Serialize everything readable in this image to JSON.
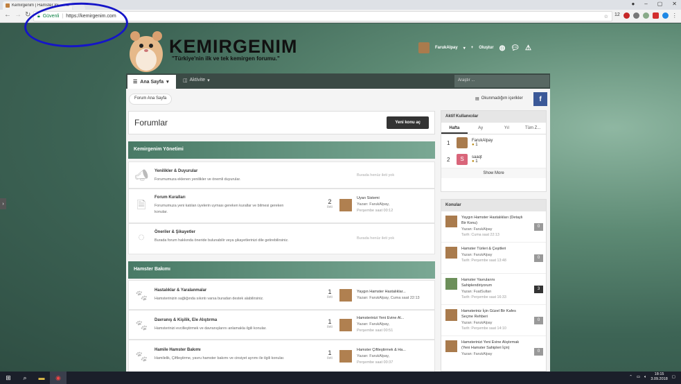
{
  "browser": {
    "tab_title": "Kemirgenim | Hamster Ini",
    "address_secure": "Güvenli",
    "address_url": "https://kemirgenim.com",
    "ext_number": "12"
  },
  "site": {
    "brand": "KEMIRGENIM",
    "tagline": "\"Türkiye'nin ilk ve tek kemirgen forumu.\"",
    "username": "FarukAlpay",
    "create_label": "Oluştur"
  },
  "nav": {
    "home": "Ana Sayfa",
    "activity": "Aktivite",
    "search_placeholder": "Araştır ..."
  },
  "breadcrumb": "Forum Ana Sayfa",
  "unread_label": "Okunmadığım içerikler",
  "fb_label": "f",
  "forums_title": "Forumlar",
  "new_topic": "Yeni konu aç",
  "categories": [
    {
      "title": "Kemirgenim Yönetimi",
      "forums": [
        {
          "name": "Yenilikler & Duyurular",
          "desc": "Forumumuza eklenen yenilikler ve önemli duyurular.",
          "empty": "Burada henüz ileti yok"
        },
        {
          "name": "Forum Kuralları",
          "desc": "Forumumuza yeni katılan üyelerin uyması gereken kurallar ve bilmesi gereken konular.",
          "count": "2",
          "count_label": "ileti",
          "last_title": "Uyarı Sistemi",
          "last_by": "Yazan: FarukAlpay,",
          "last_time": "Perşembe saat 00:12"
        },
        {
          "name": "Öneriler & Şikayetler",
          "desc": "Burada forum hakkında öneride bulunabilir veya şikayetlerinizi dile getirebilirsiniz.",
          "empty": "Burada henüz ileti yok"
        }
      ]
    },
    {
      "title": "Hamster Bakımı",
      "forums": [
        {
          "name": "Hastalıklar & Yaralanmalar",
          "desc": "Hamsterinizin sağlığında sıkıntı varsa buradan destek alabilirsiniz.",
          "count": "1",
          "count_label": "ileti",
          "last_title": "Yaygın Hamster Hastalıklar...",
          "last_by": "Yazan: FarukAlpay, Cuma saat 22:13",
          "last_time": ""
        },
        {
          "name": "Davranış & Kişilik, Ele Alıştırma",
          "desc": "Hamsterinizi evcilleştirmek ve davranışlarını anlamakla ilgili konular.",
          "count": "1",
          "count_label": "ileti",
          "last_title": "Hamsterinizi Yeni Evine Al...",
          "last_by": "Yazan: FarukAlpay,",
          "last_time": "Perşembe saat 00:51"
        },
        {
          "name": "Hamile Hamster Bakımı",
          "desc": "Hamilelik, Çiftleştirme, yavru hamster bakımı ve cinsiyet ayrımı ile ilgili konular.",
          "count": "1",
          "count_label": "ileti",
          "last_title": "Hamster Çiftleştirmek & Ha...",
          "last_by": "Yazan: FarukAlpay,",
          "last_time": "Perşembe saat 00:37"
        }
      ]
    }
  ],
  "active_users": {
    "title": "Aktif Kullanıcılar",
    "tabs": [
      "Hafta",
      "Ay",
      "Yıl",
      "Tüm Z..."
    ],
    "users": [
      {
        "rank": "1",
        "name": "FarukAlpay",
        "points": "1",
        "color": "#a97b4d",
        "initial": ""
      },
      {
        "rank": "2",
        "name": "saaqt",
        "points": "1",
        "color": "#d9657a",
        "initial": "S"
      }
    ],
    "show_more": "Show More"
  },
  "topics": {
    "title": "Konular",
    "items": [
      {
        "title": "Yaygın Hamster Hastalıkları (Detaylı Bir Konu)",
        "by": "Yazan: FarukAlpay",
        "date": "Tarih: Cuma saat 22:13",
        "count": "0"
      },
      {
        "title": "Hamster Türleri & Çeşitleri",
        "by": "Yazan: FarukAlpay",
        "date": "Tarih: Perşembe saat 13:48",
        "count": "0"
      },
      {
        "title": "Hamster Yavrularını Sahiplendiriyorum",
        "by": "Yazan: FuatSultan",
        "date": "Tarih: Perşembe saat 16:33",
        "count": "3"
      },
      {
        "title": "Hamsteriniz İçin Güzel Bir Kafes Seçme Rehberi",
        "by": "Yazan: FarukAlpay",
        "date": "Tarih: Perşembe saat 14:10",
        "count": "0"
      },
      {
        "title": "Hamsterinizi Yeni Evine Alıştırmak (Yeni Hamster Sahipleri İçin)",
        "by": "Yazan: FarukAlpay",
        "date": "",
        "count": "0"
      }
    ]
  },
  "taskbar": {
    "time": "18:15",
    "date": "3.09.2018"
  },
  "colors": {
    "accent": "#497a66",
    "annotation": "#1515c8"
  }
}
